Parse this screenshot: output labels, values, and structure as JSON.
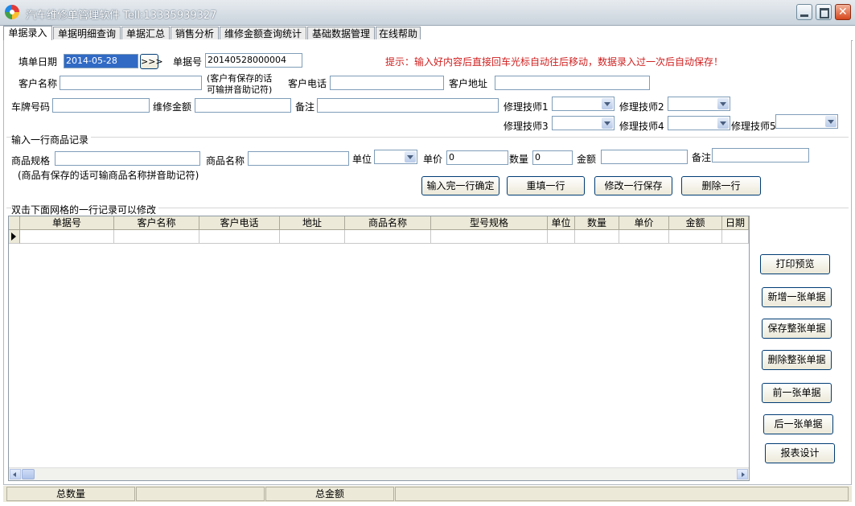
{
  "window": {
    "title": "汽车维修单管理软件 Tell:13335939327"
  },
  "tabs": [
    "单据录入",
    "单据明细查询",
    "单据汇总",
    "销售分析",
    "维修金额查询统计",
    "基础数据管理",
    "在线帮助"
  ],
  "form": {
    "date_label": "填单日期",
    "date_value": "2014-05-28",
    "date_btn": ">>>",
    "bill_label": "单据号",
    "bill_value": "20140528000004",
    "hint": "提示：输入好内容后直接回车光标自动往后移动，数据录入过一次后自动保存！",
    "customer_name_label": "客户名称",
    "customer_note_1": "(客户有保存的话",
    "customer_note_2": "可输拼音助记符)",
    "customer_phone_label": "客户电话",
    "customer_addr_label": "客户地址",
    "plate_label": "车牌号码",
    "repair_amount_label": "维修金额",
    "remark_label": "备注",
    "tech1": "修理技师1",
    "tech2": "修理技师2",
    "tech3": "修理技师3",
    "tech4": "修理技师4",
    "tech5": "修理技师5"
  },
  "goods": {
    "section_title": "输入一行商品记录",
    "spec_label": "商品规格",
    "name_label": "商品名称",
    "unit_label": "单位",
    "price_label": "单价",
    "price_value": "0",
    "qty_label": "数量",
    "qty_value": "0",
    "amount_label": "金额",
    "remark_label": "备注",
    "note": "(商品有保存的话可输商品名称拼音助记符)",
    "btn_confirm": "输入完一行确定",
    "btn_refill": "重填一行",
    "btn_modify": "修改一行保存",
    "btn_delete": "删除一行"
  },
  "grid": {
    "section_title": "双击下面网格的一行记录可以修改",
    "columns": [
      "单据号",
      "客户名称",
      "客户电话",
      "地址",
      "商品名称",
      "型号规格",
      "单位",
      "数量",
      "单价",
      "金额",
      "日期"
    ]
  },
  "side_buttons": [
    "打印预览",
    "新增一张单据",
    "保存整张单据",
    "删除整张单据",
    "前一张单据",
    "后一张单据",
    "报表设计"
  ],
  "status": {
    "total_qty": "总数量",
    "total_amount": "总金额"
  }
}
